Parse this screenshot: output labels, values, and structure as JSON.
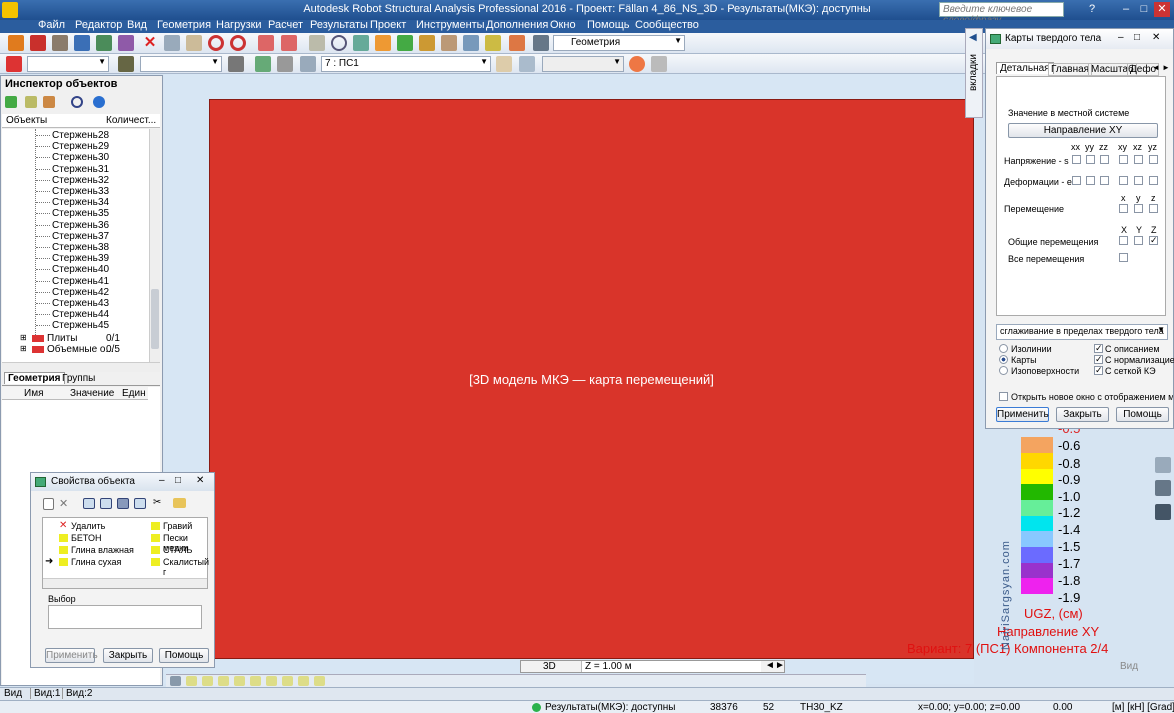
{
  "app": {
    "title": "Autodesk Robot Structural Analysis Professional 2016 - Проект: Fällan 4_86_NS_3D - Результаты(МКЭ): доступны",
    "search_placeholder": "Введите ключевое слово/фразу",
    "win_min": "–",
    "win_max": "□",
    "win_close": "✕",
    "help": "?"
  },
  "menu": [
    "Файл",
    "Редактор",
    "Вид",
    "Геометрия",
    "Нагрузки",
    "Расчет",
    "Результаты",
    "Проект",
    "Инструменты",
    "Дополнения",
    "Окно",
    "Помощь",
    "Сообщество"
  ],
  "toolbar": {
    "layout_combo": "Геометрия",
    "case_combo": "7 : ПС1"
  },
  "inspector": {
    "title": "Инспектор объектов",
    "col_objects": "Объекты",
    "col_count": "Количест...",
    "rows": [
      {
        "name": "Стержень",
        "count": "28"
      },
      {
        "name": "Стержень",
        "count": "29"
      },
      {
        "name": "Стержень",
        "count": "30"
      },
      {
        "name": "Стержень",
        "count": "31"
      },
      {
        "name": "Стержень",
        "count": "32"
      },
      {
        "name": "Стержень",
        "count": "33"
      },
      {
        "name": "Стержень",
        "count": "34"
      },
      {
        "name": "Стержень",
        "count": "35"
      },
      {
        "name": "Стержень",
        "count": "36"
      },
      {
        "name": "Стержень",
        "count": "37"
      },
      {
        "name": "Стержень",
        "count": "38"
      },
      {
        "name": "Стержень",
        "count": "39"
      },
      {
        "name": "Стержень",
        "count": "40"
      },
      {
        "name": "Стержень",
        "count": "41"
      },
      {
        "name": "Стержень",
        "count": "42"
      },
      {
        "name": "Стержень",
        "count": "43"
      },
      {
        "name": "Стержень",
        "count": "44"
      },
      {
        "name": "Стержень",
        "count": "45"
      }
    ],
    "groups": [
      {
        "name": "Плиты",
        "count": "0/1"
      },
      {
        "name": "Объемные о...",
        "count": "0/5"
      }
    ],
    "tab_geometry": "Геометрия",
    "tab_groups": "Группы",
    "prop_cols": [
      "Имя",
      "Значение",
      "Един"
    ]
  },
  "props_dialog": {
    "title": "Свойства объекта",
    "materials_left": [
      "Удалить",
      "БЕТОН",
      "Глина влажная",
      "Глина сухая"
    ],
    "materials_right": [
      "Гравий",
      "Пески мелки",
      "СТАЛЬ",
      "Скалистый г"
    ],
    "selection_label": "Выбор",
    "btn_apply": "Применить",
    "btn_close": "Закрыть",
    "btn_help": "Помощь"
  },
  "maps_dialog": {
    "title": "Карты твердого тела",
    "tabs": [
      "Детальная",
      "Главная",
      "Масштаб",
      "Дефо"
    ],
    "local_system_label": "Значение в местной системе",
    "direction_button": "Направление XY",
    "stress_cols": [
      "xx",
      "yy",
      "zz",
      "xy",
      "xz",
      "yz"
    ],
    "stress_label": "Напряжение - s",
    "strain_label": "Деформации - e",
    "displacement_label": "Перемещение",
    "xyz_cols": [
      "x",
      "y",
      "z"
    ],
    "xyz_cols_upper": [
      "X",
      "Y",
      "Z"
    ],
    "general_disp_label": "Общие перемещения",
    "all_disp_label": "Все перемещения",
    "smoothing": "сглаживание в пределах твердого тела",
    "opt_isolines": "Изолинии",
    "opt_maps": "Карты",
    "opt_isosurfaces": "Изоповерхности",
    "chk_description": "С описанием",
    "chk_normalized": "С нормализацией",
    "chk_mesh": "С сеткой КЭ",
    "open_new_window": "Открыть новое окно с отображением масштаб",
    "btn_apply": "Применить",
    "btn_close": "Закрыть",
    "btn_help": "Помощь",
    "side_tab": "вкладки"
  },
  "legend": {
    "top_value": "-0.5",
    "values": [
      "-0.6",
      "-0.8",
      "-0.9",
      "-1.0",
      "-1.2",
      "-1.4",
      "-1.5",
      "-1.7",
      "-1.8",
      "-1.9"
    ],
    "colors": [
      "#f4a460",
      "#ffd700",
      "#ffff00",
      "#22b800",
      "#66ee99",
      "#00e5ee",
      "#88c8ff",
      "#6b6bff",
      "#9932cc",
      "#ee22ee"
    ],
    "caption_unit": "UGZ, (см)",
    "caption_direction": "Направление XY",
    "caption_variant": "Вариант: 7 (ПС1) Компонента 2/4"
  },
  "view": {
    "placeholder": "[3D модель МКЭ — карта перемещений]",
    "mode_label": "3D",
    "z_label": "Z = 1.00 м",
    "corner_label": "Вид",
    "watermark": "NairiSargsyan.com"
  },
  "bottom_tabs": [
    "Вид",
    "Вид:1",
    "Вид:2"
  ],
  "status": {
    "results": "Результаты(МКЭ): доступны",
    "n1": "38376",
    "n2": "52",
    "material": "TH30_KZ",
    "coords": "x=0.00; y=0.00; z=0.00",
    "angle": "0.00",
    "units": "[м] [кН] [Grad]"
  }
}
